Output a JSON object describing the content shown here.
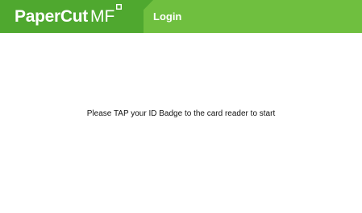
{
  "header": {
    "brand": {
      "name": "PaperCut",
      "suffix": "MF",
      "icon": "papercut-logo-icon"
    },
    "title": "Login"
  },
  "main": {
    "message": "Please TAP your ID Badge to the card reader to start"
  },
  "colors": {
    "header_green": "#6fbf3f",
    "header_dark_green": "#4fa82f",
    "background": "#ffffff",
    "text": "#111111"
  }
}
